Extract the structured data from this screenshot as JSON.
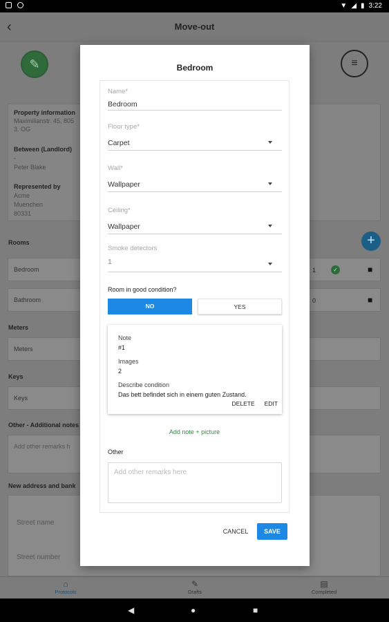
{
  "status_bar": {
    "time": "3:22"
  },
  "app_bar": {
    "title": "Move-out",
    "back_icon": "arrow-back-icon"
  },
  "property": {
    "heading": "Property information",
    "line1": "Maximilianstr. 45, 805",
    "line2": "3. OG"
  },
  "between": {
    "heading": "Between (Landlord)",
    "line1": "-",
    "line2": "Peter Blake"
  },
  "represented": {
    "heading": "Represented by",
    "line1": "Acme",
    "line2": "Muenchen",
    "line3": "80331"
  },
  "rooms": {
    "heading": "Rooms",
    "items": [
      {
        "label": "Bedroom",
        "count": "1"
      },
      {
        "label": "Bathroom",
        "count": "0"
      }
    ]
  },
  "meters": {
    "heading": "Meters",
    "field": "Meters"
  },
  "keys": {
    "heading": "Keys",
    "field": "Keys"
  },
  "other_notes": {
    "heading": "Other - Additional notes",
    "placeholder": "Add other remarks h"
  },
  "new_address": {
    "heading": "New address and bank",
    "street_name": "Street name",
    "street_number": "Street number"
  },
  "bottom_nav": {
    "items": [
      {
        "label": "Protocols",
        "icon": "home-icon",
        "active": true
      },
      {
        "label": "Drafts",
        "icon": "pencil-icon",
        "active": false
      },
      {
        "label": "Completed",
        "icon": "document-icon",
        "active": false
      }
    ]
  },
  "dialog": {
    "title": "Bedroom",
    "fields": {
      "name": {
        "label": "Name*",
        "value": "Bedroom"
      },
      "floor": {
        "label": "Floor type*",
        "value": "Carpet"
      },
      "wall": {
        "label": "Wall*",
        "value": "Wallpaper"
      },
      "ceiling": {
        "label": "Ceiling*",
        "value": "Wallpaper"
      },
      "smoke": {
        "label": "Smoke detectors",
        "value": "1"
      }
    },
    "condition_question": "Room in good condition?",
    "condition_no": "NO",
    "condition_yes": "YES",
    "condition_selected": "NO",
    "note": {
      "note_label": "Note",
      "note_value": "#1",
      "images_label": "Images",
      "images_value": "2",
      "describe_label": "Describe condition",
      "describe_value": "Das bett befindet sich in einem guten Zustand.",
      "delete": "DELETE",
      "edit": "EDIT"
    },
    "add_note": "Add note + picture",
    "other_label": "Other",
    "other_placeholder": "Add other remarks here",
    "cancel": "CANCEL",
    "save": "SAVE"
  },
  "colors": {
    "accent": "#1e88e5",
    "success": "#2e8b3a"
  }
}
